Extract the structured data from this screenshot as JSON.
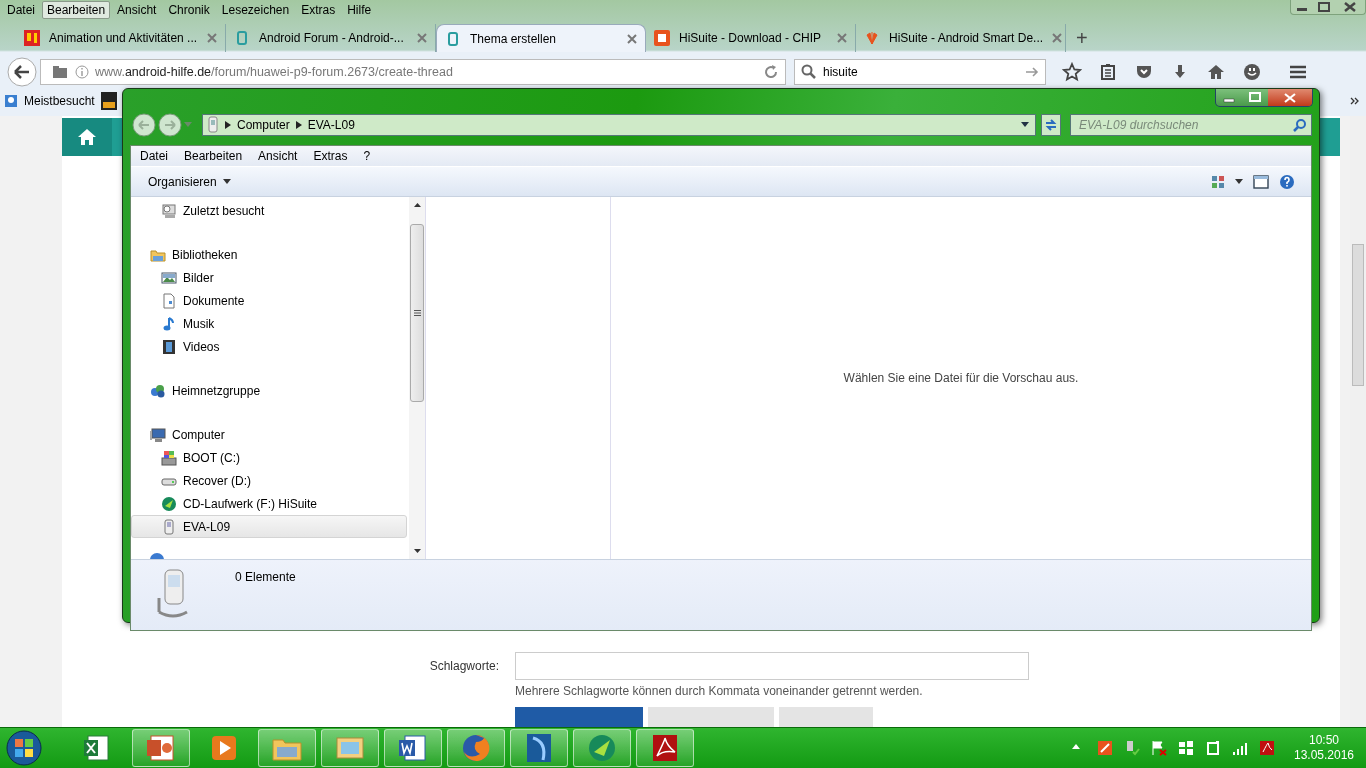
{
  "browser": {
    "menu": [
      {
        "label": "Datei",
        "selected": false
      },
      {
        "label": "Bearbeiten",
        "selected": true
      },
      {
        "label": "Ansicht",
        "selected": false
      },
      {
        "label": "Chronik",
        "selected": false
      },
      {
        "label": "Lesezeichen",
        "selected": false
      },
      {
        "label": "Extras",
        "selected": false
      },
      {
        "label": "Hilfe",
        "selected": false
      }
    ],
    "tabs": [
      {
        "label": "Animation und Aktivitäten ...",
        "selected": false
      },
      {
        "label": "Android Forum - Android-...",
        "selected": false
      },
      {
        "label": "Thema erstellen",
        "selected": true
      },
      {
        "label": "HiSuite - Download - CHIP",
        "selected": false
      },
      {
        "label": "HiSuite - Android Smart De...",
        "selected": false
      }
    ],
    "new_tab": "+",
    "address": "www.**android-hilfe.de**/forum/huawei-p9-forum.2673/create-thread",
    "search": {
      "value": "hisuite"
    },
    "bookmarks": [
      "Meistbesucht"
    ]
  },
  "page": {
    "tags_label": "Schlagworte:",
    "tags_hint": "Mehrere Schlagworte können durch Kommata voneinander getrennt werden."
  },
  "explorer": {
    "breadcrumb": [
      "Computer",
      "EVA-L09"
    ],
    "search": {
      "placeholder": "EVA-L09 durchsuchen"
    },
    "menu": [
      "Datei",
      "Bearbeiten",
      "Ansicht",
      "Extras",
      "?"
    ],
    "toolbar": {
      "organize": "Organisieren"
    },
    "nav": [
      {
        "children": [
          {
            "label": "Zuletzt besucht",
            "selected": false
          }
        ]
      },
      {
        "label": "Bibliotheken",
        "selected": false,
        "children": [
          {
            "label": "Bilder",
            "selected": false
          },
          {
            "label": "Dokumente",
            "selected": false
          },
          {
            "label": "Musik",
            "selected": false
          },
          {
            "label": "Videos",
            "selected": false
          }
        ]
      },
      {
        "label": "Heimnetzgruppe",
        "selected": false
      },
      {
        "label": "Computer",
        "selected": false,
        "children": [
          {
            "label": "BOOT (C:)",
            "selected": false
          },
          {
            "label": "Recover (D:)",
            "selected": false
          },
          {
            "label": "CD-Laufwerk (F:) HiSuite",
            "selected": false
          },
          {
            "label": "EVA-L09",
            "selected": true
          }
        ]
      }
    ],
    "preview_message": "Wählen Sie eine Datei für die Vorschau aus.",
    "status": "0 Elemente"
  },
  "taskbar": {
    "apps": [
      {
        "running": false
      },
      {
        "running": true
      },
      {
        "running": false
      },
      {
        "running": true
      },
      {
        "running": true
      },
      {
        "running": true
      },
      {
        "running": true
      },
      {
        "running": true
      },
      {
        "running": true
      },
      {
        "running": true
      }
    ],
    "clock": {
      "time": "10:50",
      "date": "13.05.2016"
    }
  }
}
